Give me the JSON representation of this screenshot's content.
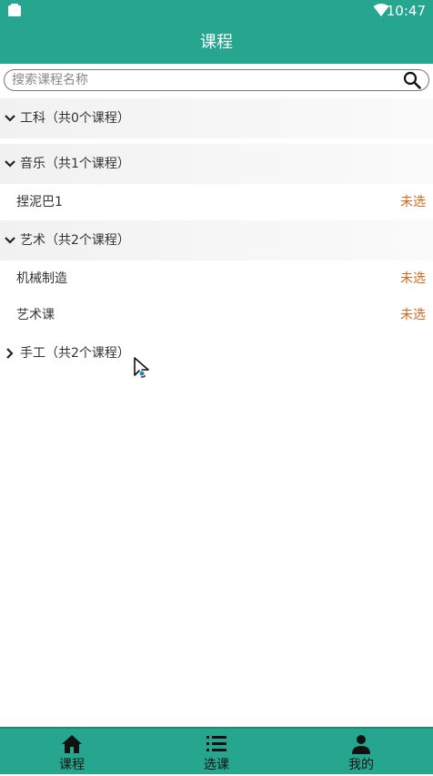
{
  "status_bar": {
    "time": "10:47"
  },
  "app_bar": {
    "title": "课程"
  },
  "search": {
    "placeholder": "搜索课程名称",
    "value": ""
  },
  "groups": [
    {
      "title": "工科（共0个课程）",
      "expanded": true,
      "courses": []
    },
    {
      "title": "音乐（共1个课程）",
      "expanded": true,
      "courses": [
        {
          "name": "捏泥巴1",
          "status": "未选"
        }
      ]
    },
    {
      "title": "艺术（共2个课程）",
      "expanded": true,
      "courses": [
        {
          "name": "机械制造",
          "status": "未选"
        },
        {
          "name": "艺术课",
          "status": "未选"
        }
      ]
    },
    {
      "title": "手工（共2个课程）",
      "expanded": false,
      "courses": []
    }
  ],
  "bottom_nav": {
    "items": [
      {
        "label": "课程",
        "icon": "home-icon"
      },
      {
        "label": "选课",
        "icon": "list-icon"
      },
      {
        "label": "我的",
        "icon": "person-icon"
      }
    ]
  },
  "colors": {
    "primary": "#26a68e",
    "status_unselected": "#d2691e"
  }
}
